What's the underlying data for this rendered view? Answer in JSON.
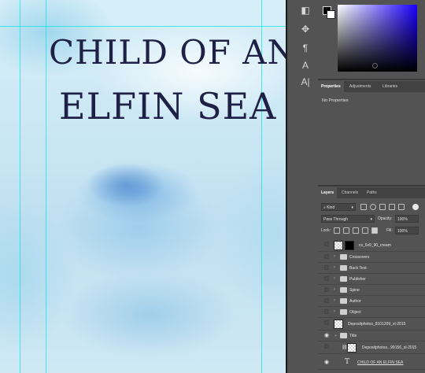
{
  "document": {
    "title_line1": "CHILD OF AN",
    "title_line2": "ELFIN SEA"
  },
  "toolbar": {
    "icons": [
      "shape-tool-icon",
      "move-tool-icon",
      "paragraph-icon",
      "character-icon",
      "paragraph-styles-icon"
    ],
    "glyphs": [
      "◧",
      "✥",
      "¶",
      "A",
      "A|"
    ]
  },
  "properties_panel": {
    "tabs": [
      "Properties",
      "Adjustments",
      "Libraries"
    ],
    "message": "No Properties"
  },
  "layers_panel": {
    "tabs": [
      "Layers",
      "Channels",
      "Paths"
    ],
    "kind_filter": "Kind",
    "blend_mode": "Pass Through",
    "opacity_label": "Opacity:",
    "opacity_value": "100%",
    "lock_label": "Lock:",
    "fill_label": "Fill:",
    "fill_value": "100%",
    "layers": [
      {
        "name": "cs_6x9_90_cream",
        "visible": false,
        "type": "smart-object"
      },
      {
        "name": "Crossovers",
        "visible": false,
        "type": "group"
      },
      {
        "name": "Back Text",
        "visible": false,
        "type": "group"
      },
      {
        "name": "Publisher",
        "visible": false,
        "type": "group"
      },
      {
        "name": "Spine",
        "visible": false,
        "type": "group"
      },
      {
        "name": "Author",
        "visible": false,
        "type": "group"
      },
      {
        "name": "Object",
        "visible": false,
        "type": "group"
      },
      {
        "name": "Depositphotos_8101209_xl-2015",
        "visible": false,
        "type": "image"
      },
      {
        "name": "Title",
        "visible": true,
        "type": "group"
      },
      {
        "name": "Depositphotos...99156_xl-2015",
        "visible": false,
        "type": "image"
      },
      {
        "name": "CHILD OF AN ELFIN SEA",
        "visible": true,
        "type": "text"
      }
    ]
  }
}
